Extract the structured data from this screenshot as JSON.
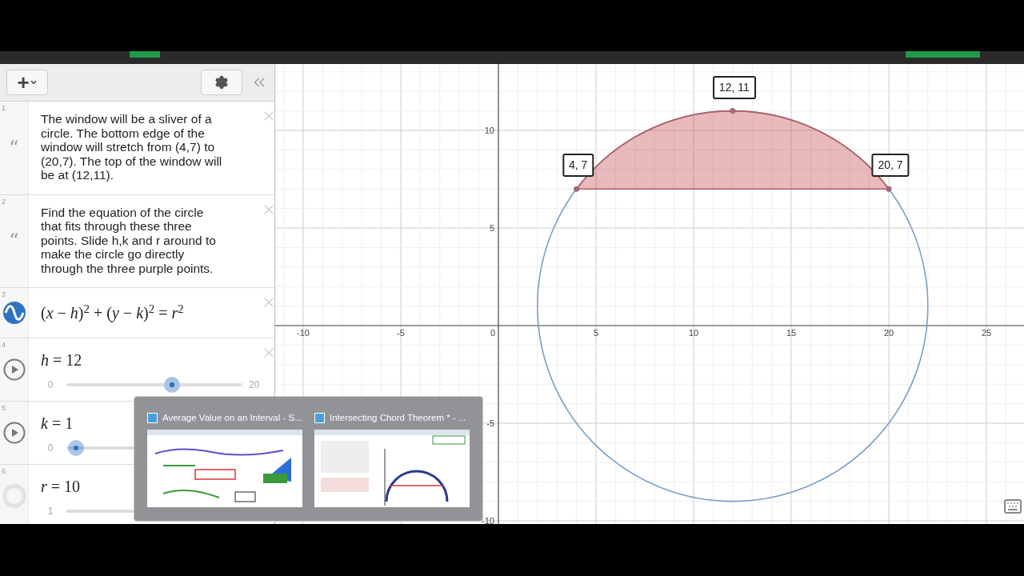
{
  "toolbar": {
    "add_label": "+"
  },
  "items": [
    {
      "index": "1",
      "kind": "note",
      "quote_mark": "“",
      "text": "The window will be a sliver of a circle. The bottom edge of the window will stretch from (4,7) to (20,7). The top of the window will be at (12,11).",
      "close_visible": true
    },
    {
      "index": "2",
      "kind": "note",
      "quote_mark": "“",
      "text": "Find the equation of the circle that fits through these three points. Slide h,k and r around to make the circle go directly through the three purple points.",
      "close_visible": true
    },
    {
      "index": "3",
      "kind": "expression",
      "latex": "(*x* − *h*)$^{2}$ + (*y* − *k*)$^{2}$ = *r*$^{2}$",
      "close_visible": true
    },
    {
      "index": "4",
      "kind": "slider",
      "latex": "*h* = 12",
      "min": "0",
      "max": "20",
      "level": 0.6,
      "close_visible": true
    },
    {
      "index": "5",
      "kind": "slider",
      "latex": "*k* = 1",
      "min": "0"
    },
    {
      "index": "6",
      "kind": "hidden_slider",
      "latex": "*r* = 10",
      "min": "1"
    }
  ],
  "graph": {
    "x_ticks": [
      "-10",
      "-5",
      "0",
      "5",
      "10",
      "15",
      "20",
      "25"
    ],
    "y_ticks": [
      "10",
      "5",
      "-5",
      "-10"
    ],
    "point_labels": [
      "4, 7",
      "12, 11",
      "20, 7"
    ]
  },
  "taskbar_preview": [
    {
      "title": "Average Value on an Interval - S..."
    },
    {
      "title": "Intersecting Chord Theorem * - ..."
    }
  ]
}
